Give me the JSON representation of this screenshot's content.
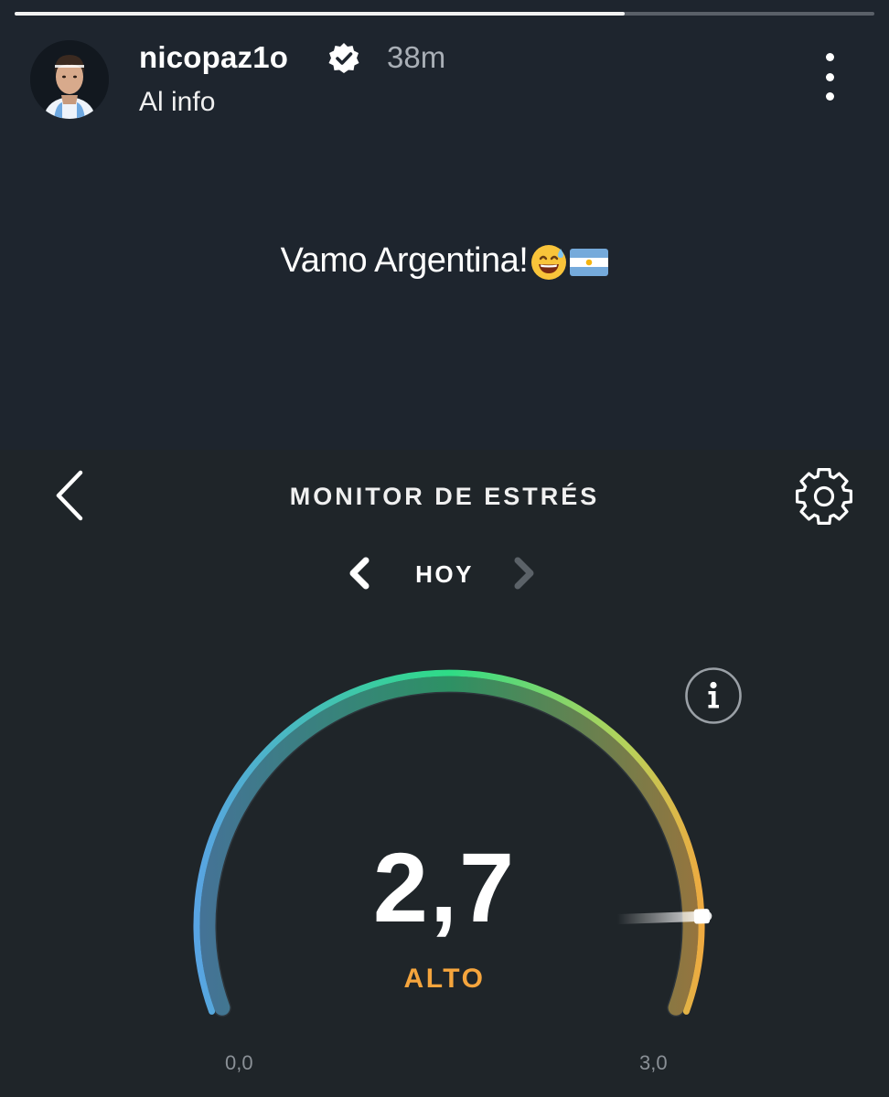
{
  "story": {
    "progress": 0.71,
    "username": "nicopaz1o",
    "verified": true,
    "time_ago": "38m",
    "subtitle": "Al info",
    "caption": "Vamo Argentina!",
    "caption_emojis": [
      "sweat-smile-emoji",
      "argentina-flag-emoji"
    ],
    "icons": {
      "avatar": "profile-photo",
      "verified": "verified-badge-icon",
      "more": "more-options-icon"
    }
  },
  "app": {
    "title": "MONITOR DE ESTRÉS",
    "period": "HOY",
    "icons": {
      "back": "chevron-left-icon",
      "settings": "gear-icon",
      "prev": "chevron-left-icon",
      "next": "chevron-right-icon",
      "info": "info-icon"
    }
  },
  "gauge": {
    "value": 2.7,
    "value_label": "2,7",
    "level": "ALTO",
    "min": 0.0,
    "max": 3.0,
    "min_label": "0,0",
    "max_label": "3,0",
    "colors": {
      "start": "#5aa2e6",
      "mid": "#2edc86",
      "end": "#f5a53d",
      "level": "#f5a53d",
      "track": "#2d353b"
    }
  }
}
